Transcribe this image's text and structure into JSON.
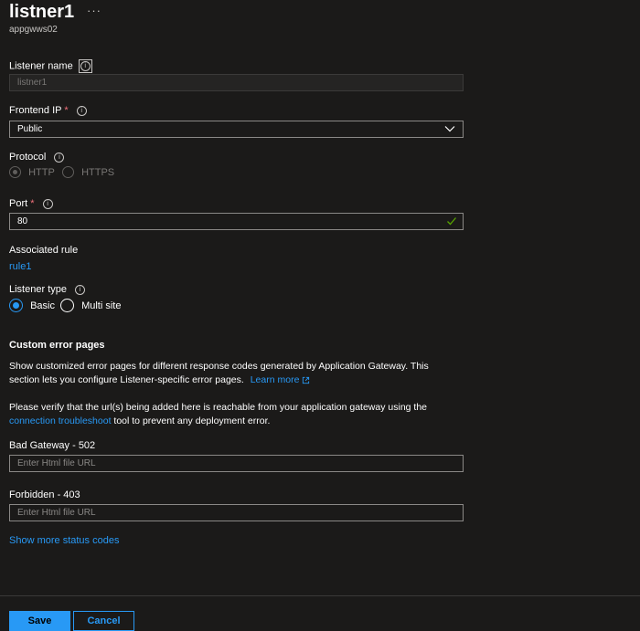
{
  "header": {
    "title": "listner1",
    "subtitle": "appgwws02",
    "more": "···"
  },
  "listener_name": {
    "label": "Listener name",
    "value": "listner1"
  },
  "frontend_ip": {
    "label": "Frontend IP",
    "required": "*",
    "value": "Public"
  },
  "protocol": {
    "label": "Protocol",
    "options": [
      "HTTP",
      "HTTPS"
    ],
    "selected": "HTTP"
  },
  "port": {
    "label": "Port",
    "required": "*",
    "value": "80"
  },
  "associated_rule": {
    "label": "Associated rule",
    "link": "rule1"
  },
  "listener_type": {
    "label": "Listener type",
    "options": [
      "Basic",
      "Multi site"
    ],
    "selected": "Basic"
  },
  "custom_errors": {
    "title": "Custom error pages",
    "desc": "Show customized error pages for different response codes generated by Application Gateway. This section lets you configure Listener-specific error pages.",
    "learn_more": "Learn more",
    "verify_pre": "Please verify that the url(s) being added here is reachable from your application gateway using the",
    "verify_link": "connection troubleshoot",
    "verify_post": "tool to prevent any deployment error.",
    "bad_gateway_label": "Bad Gateway - 502",
    "forbidden_label": "Forbidden - 403",
    "url_placeholder": "Enter Html file URL",
    "show_more": "Show more status codes"
  },
  "footer": {
    "save": "Save",
    "cancel": "Cancel"
  },
  "colors": {
    "accent": "#2899f5",
    "background": "#1b1a19",
    "required": "#f1707b"
  }
}
